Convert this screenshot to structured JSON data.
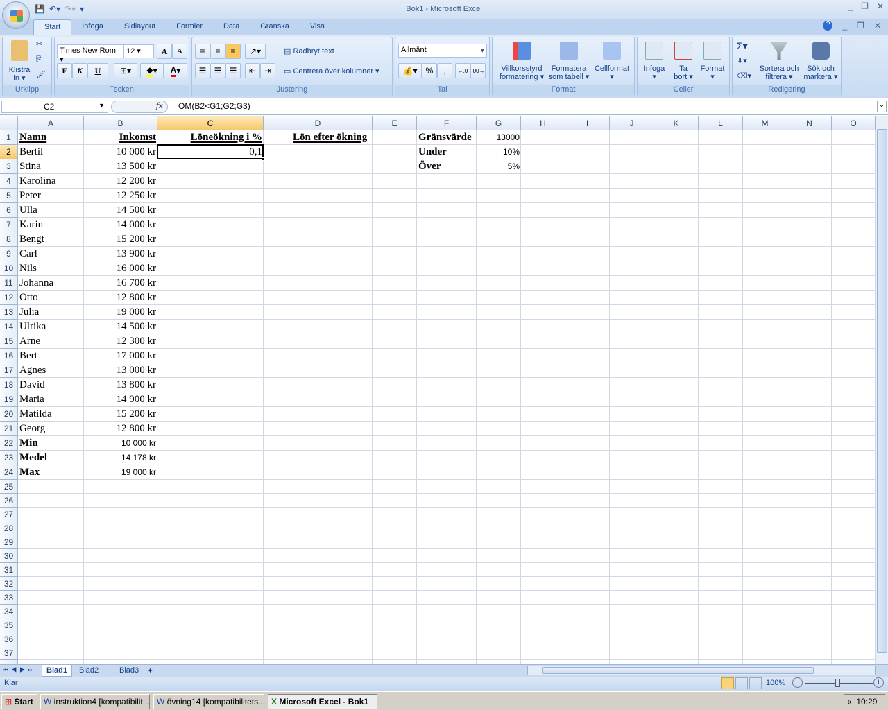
{
  "window": {
    "title": "Bok1 - Microsoft Excel"
  },
  "ribbon_tabs": [
    "Start",
    "Infoga",
    "Sidlayout",
    "Formler",
    "Data",
    "Granska",
    "Visa"
  ],
  "ribbon": {
    "clipboard": {
      "paste": "Klistra",
      "paste2": "in",
      "label": "Urklipp"
    },
    "font": {
      "name": "Times New Rom",
      "size": "12",
      "bold": "F",
      "italic": "K",
      "underline": "U",
      "label": "Tecken",
      "grow": "A",
      "shrink": "A",
      "color_letter": "A"
    },
    "alignment": {
      "wrap": "Radbryt text",
      "merge": "Centrera över kolumner",
      "label": "Justering"
    },
    "number": {
      "format": "Allmänt",
      "percent": "%",
      "comma": ",",
      "label": "Tal"
    },
    "styles": {
      "conditional": "Villkorsstyrd",
      "conditional2": "formatering",
      "table": "Formatera",
      "table2": "som tabell",
      "cell": "Cellformat",
      "label": "Format"
    },
    "cells": {
      "insert": "Infoga",
      "delete": "Ta",
      "delete2": "bort",
      "format": "Format",
      "label": "Celler"
    },
    "editing": {
      "sum": "Σ",
      "sort": "Sortera och",
      "sort2": "filtrera",
      "find": "Sök och",
      "find2": "markera",
      "label": "Redigering"
    }
  },
  "formula_bar": {
    "name_box": "C2",
    "fx": "fx",
    "formula": "=OM(B2<G1;G2;G3)"
  },
  "columns": [
    "A",
    "B",
    "C",
    "D",
    "E",
    "F",
    "G",
    "H",
    "I",
    "J",
    "K",
    "L",
    "M",
    "N",
    "O"
  ],
  "selected": {
    "column": "C",
    "row": 2
  },
  "cells": {
    "headers": {
      "A1": "Namn",
      "B1": "Inkomst",
      "C1": "Löneökning i %",
      "D1": "Lön efter ökning"
    },
    "C2": "0,1",
    "side": [
      {
        "label": "Gränsvärde",
        "value": "13000"
      },
      {
        "label": "Under",
        "value": "10%"
      },
      {
        "label": "Över",
        "value": "5%"
      }
    ],
    "rows": [
      [
        "Bertil",
        "10 000 kr"
      ],
      [
        "Stina",
        "13 500 kr"
      ],
      [
        "Karolina",
        "12 200 kr"
      ],
      [
        "Peter",
        "12 250 kr"
      ],
      [
        "Ulla",
        "14 500 kr"
      ],
      [
        "Karin",
        "14 000 kr"
      ],
      [
        "Bengt",
        "15 200 kr"
      ],
      [
        "Carl",
        "13 900 kr"
      ],
      [
        "Nils",
        "16 000 kr"
      ],
      [
        "Johanna",
        "16 700 kr"
      ],
      [
        "Otto",
        "12 800 kr"
      ],
      [
        "Julia",
        "19 000 kr"
      ],
      [
        "Ulrika",
        "14 500 kr"
      ],
      [
        "Arne",
        "12 300 kr"
      ],
      [
        "Bert",
        "17 000 kr"
      ],
      [
        "Agnes",
        "13 000 kr"
      ],
      [
        "David",
        "13 800 kr"
      ],
      [
        "Maria",
        "14 900 kr"
      ],
      [
        "Matilda",
        "15 200 kr"
      ],
      [
        "Georg",
        "12 800 kr"
      ]
    ],
    "stats": [
      [
        "Min",
        "10 000 kr"
      ],
      [
        "Medel",
        "14 178 kr"
      ],
      [
        "Max",
        "19 000 kr"
      ]
    ]
  },
  "sheets": [
    "Blad1",
    "Blad2",
    "Blad3"
  ],
  "status": {
    "text": "Klar",
    "zoom": "100%"
  },
  "taskbar": {
    "start": "Start",
    "items": [
      "instruktion4 [kompatibilit...",
      "övning14 [kompatibilitets...",
      "Microsoft Excel - Bok1"
    ],
    "clock": "10:29"
  }
}
